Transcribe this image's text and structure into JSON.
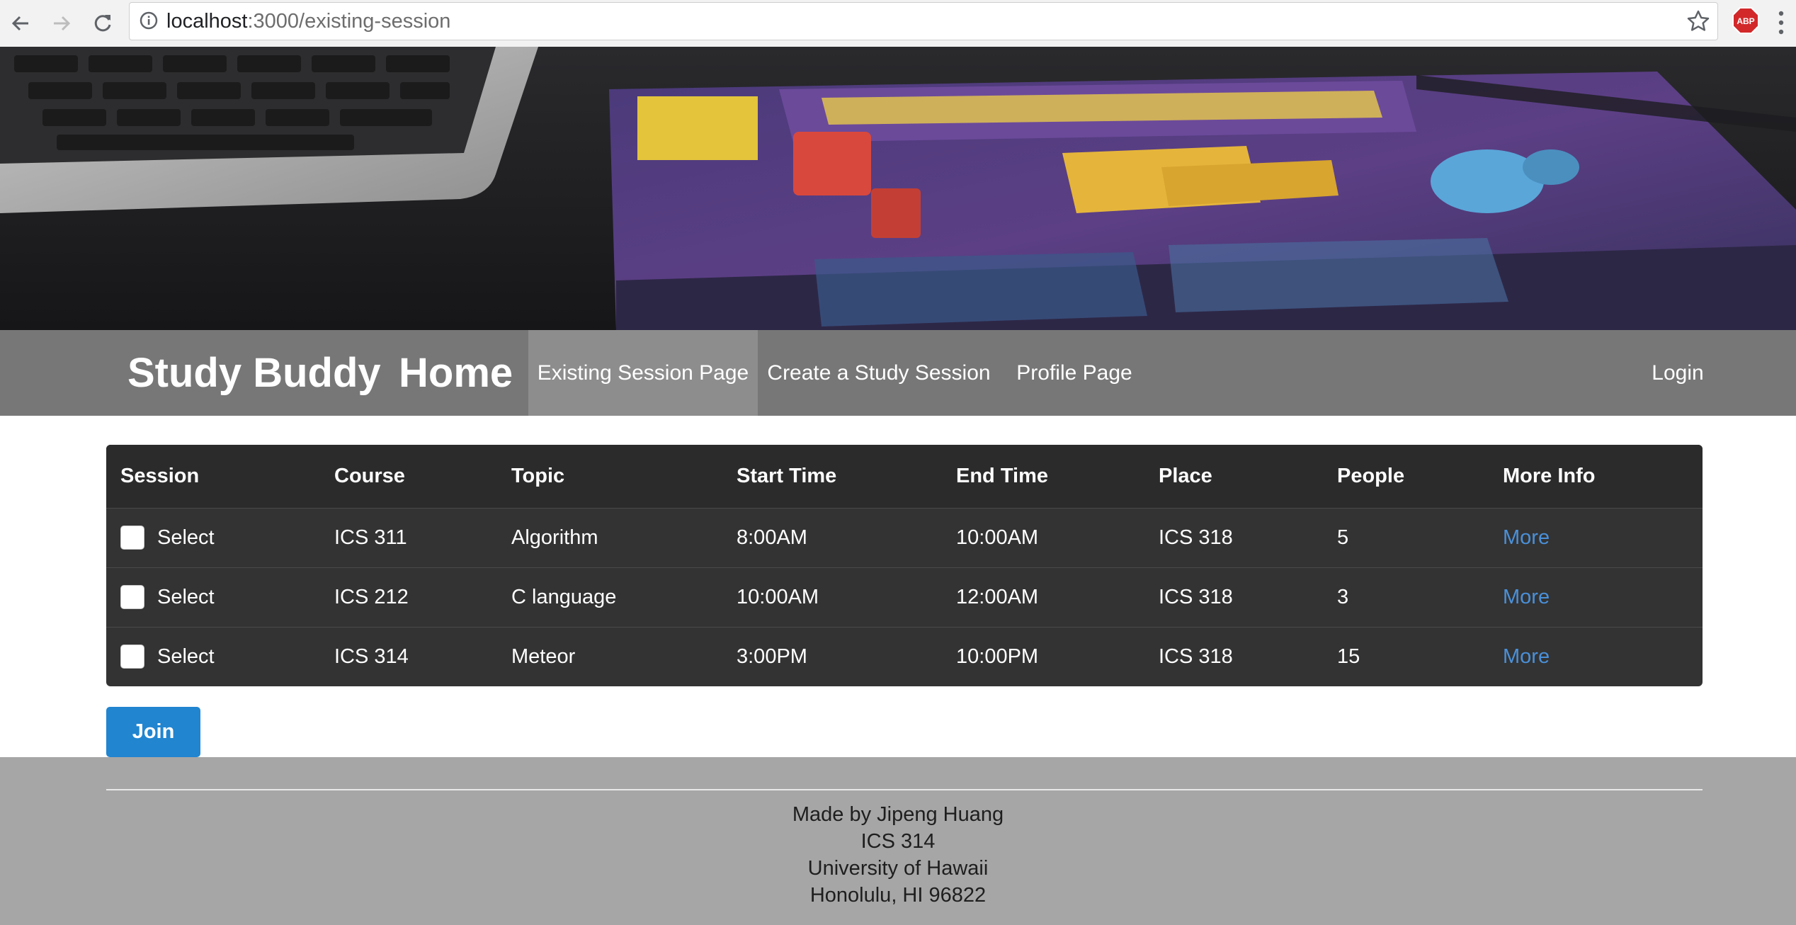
{
  "browser": {
    "url_host": "localhost",
    "url_path": ":3000/existing-session",
    "extension_badge": "ABP",
    "icons": [
      "back-arrow-icon",
      "forward-arrow-icon",
      "reload-icon",
      "info-icon",
      "star-icon",
      "adblock-icon",
      "kebab-menu-icon"
    ]
  },
  "nav": {
    "brand": "Study Buddy",
    "home": "Home",
    "existing_session": "Existing Session Page",
    "create_session": "Create a Study Session",
    "profile": "Profile Page",
    "login": "Login"
  },
  "table": {
    "headers": [
      "Session",
      "Course",
      "Topic",
      "Start Time",
      "End Time",
      "Place",
      "People",
      "More Info"
    ],
    "rows": [
      {
        "select": "Select",
        "course": "ICS 311",
        "topic": "Algorithm",
        "start": "8:00AM",
        "end": "10:00AM",
        "place": "ICS 318",
        "people": "5",
        "more": "More"
      },
      {
        "select": "Select",
        "course": "ICS 212",
        "topic": "C language",
        "start": "10:00AM",
        "end": "12:00AM",
        "place": "ICS 318",
        "people": "3",
        "more": "More"
      },
      {
        "select": "Select",
        "course": "ICS 314",
        "topic": "Meteor",
        "start": "3:00PM",
        "end": "10:00PM",
        "place": "ICS 318",
        "people": "15",
        "more": "More"
      }
    ]
  },
  "join_button": "Join",
  "footer": {
    "lines": [
      "Made by Jipeng Huang",
      "ICS 314",
      "University of Hawaii",
      "Honolulu, HI 96822"
    ]
  },
  "colors": {
    "menu_bg": "#777777",
    "menu_active": "#8d8d8d",
    "table_bg": "#333333",
    "link": "#4a90d9",
    "primary": "#2185d0",
    "footer_bg": "#a6a6a6"
  }
}
